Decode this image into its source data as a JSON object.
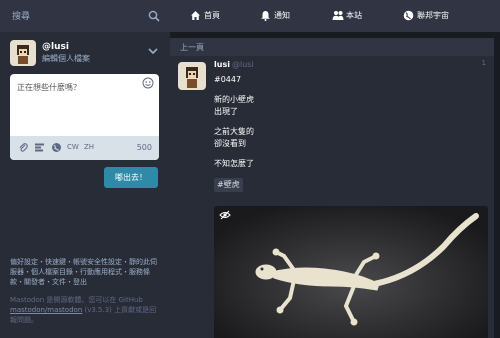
{
  "search": {
    "placeholder": "搜尋"
  },
  "account": {
    "name": "@lusi",
    "edit_profile": "編輯個人檔案"
  },
  "composer": {
    "placeholder": "正在想些什麼嗎？",
    "tools": {
      "cw": "CW",
      "lang": "ZH"
    },
    "char_count": "500",
    "submit_label": "嘟出去！"
  },
  "footer": {
    "links": "偏好設定・快速鍵・帳號安全性設定・靜的此伺服器・個人檔案目錄・行動應用程式・服務條款・關發者・文件・登出",
    "source_prefix": "Mastodon 是開源軟體。您可以在 GitHub ",
    "source_link": "mastodon/mastodon",
    "source_suffix": " (v3.5.3) 上貢獻或是回報問題。"
  },
  "nav": {
    "home": "首頁",
    "notifications": "通知",
    "local": "本站",
    "federated": "聯邦宇宙"
  },
  "column": {
    "back_label": "上一頁"
  },
  "status": {
    "display_name": "lusi",
    "handle": "@lusi",
    "meta": "1",
    "lines": [
      "#0447",
      "新的小壁虎\n出現了",
      "之前大隻的\n卻沒看到",
      "不知怎麼了"
    ],
    "hashtag": "#壁虎"
  },
  "icons": {
    "search": "search-icon",
    "home": "home-icon",
    "bell": "bell-icon",
    "users": "users-icon",
    "globe": "globe-icon",
    "eye": "eye-slash-icon"
  },
  "colors": {
    "accent": "#2e8aa6",
    "bg": "#191b22",
    "panel": "#282c37"
  }
}
